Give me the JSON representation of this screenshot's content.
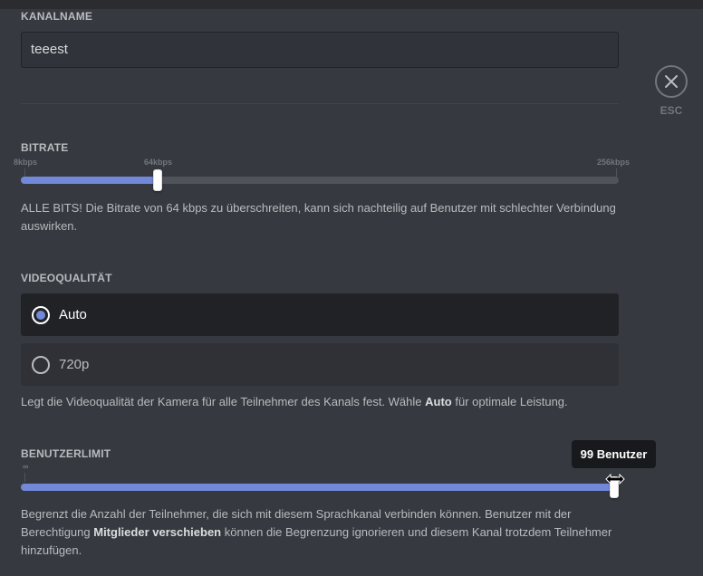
{
  "channel_name": {
    "label": "KANALNAME",
    "value": "teeest"
  },
  "close": {
    "esc_label": "ESC"
  },
  "bitrate": {
    "label": "BITRATE",
    "min_label": "8kbps",
    "current_label": "64kbps",
    "max_label": "256kbps",
    "min": 8,
    "max": 256,
    "value": 64,
    "description": "ALLE BITS! Die Bitrate von 64 kbps zu überschreiten, kann sich nachteilig auf Benutzer mit schlechter Verbindung auswirken."
  },
  "video_quality": {
    "label": "VIDEOQUALITÄT",
    "options": [
      {
        "label": "Auto",
        "selected": true
      },
      {
        "label": "720p",
        "selected": false
      }
    ],
    "description_pre": "Legt die Videoqualität der Kamera für alle Teilnehmer des Kanals fest. Wähle ",
    "description_bold": "Auto",
    "description_post": " für optimale Leistung."
  },
  "user_limit": {
    "label": "BENUTZERLIMIT",
    "min_label": "∞",
    "value": 99,
    "tooltip": "99 Benutzer",
    "description_pre": "Begrenzt die Anzahl der Teilnehmer, die sich mit diesem Sprachkanal verbinden können. Benutzer mit der Berechtigung ",
    "description_bold": "Mitglieder verschieben",
    "description_post": " können die Begrenzung ignorieren und diesem Kanal trotzdem Teilnehmer hinzufügen."
  },
  "colors": {
    "accent": "#7289da",
    "background": "#36393f"
  },
  "icons": {
    "close": "close-icon",
    "cursor": "resize-horizontal-cursor-icon"
  }
}
